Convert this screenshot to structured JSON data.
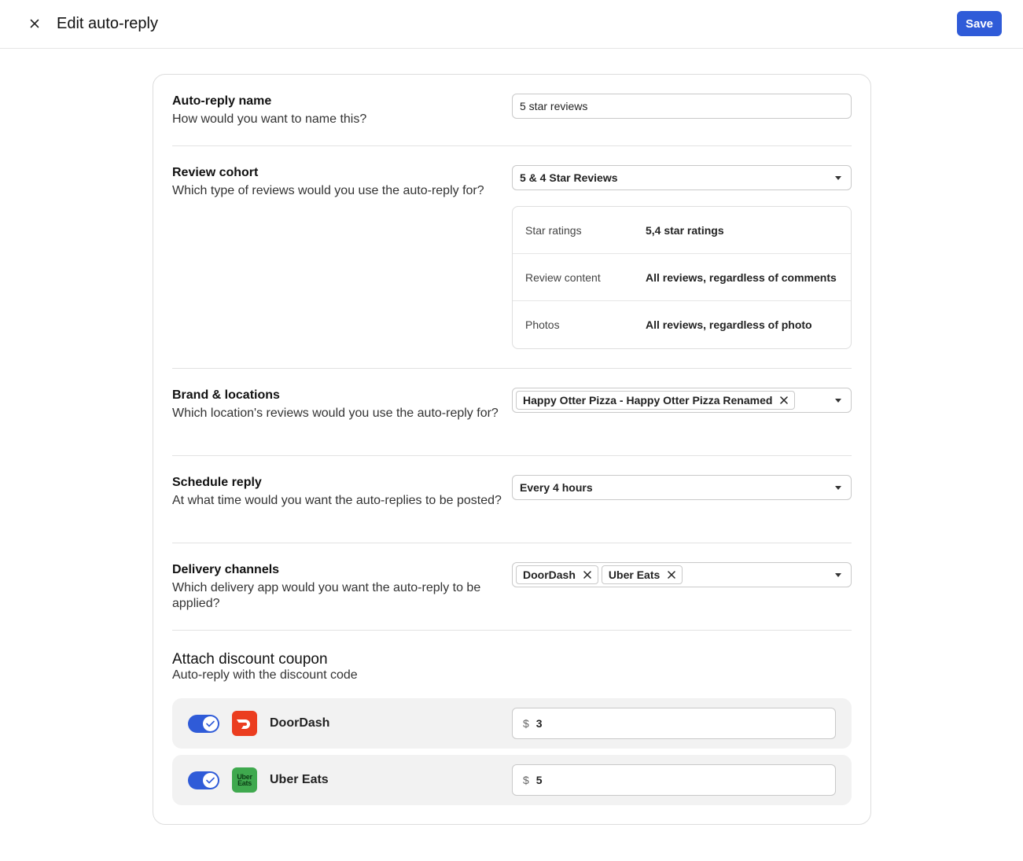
{
  "header": {
    "title": "Edit auto-reply",
    "save_label": "Save"
  },
  "auto_reply_name": {
    "title": "Auto-reply name",
    "description": "How would you want to name this?",
    "value": "5 star reviews"
  },
  "review_cohort": {
    "title": "Review cohort",
    "description": "Which type of reviews would you use the auto-reply for?",
    "selected": "5 & 4 Star Reviews",
    "details": [
      {
        "label": "Star ratings",
        "value": "5,4 star ratings"
      },
      {
        "label": "Review content",
        "value": "All reviews, regardless of comments"
      },
      {
        "label": "Photos",
        "value": "All reviews, regardless of photo"
      }
    ]
  },
  "brand_locations": {
    "title": "Brand & locations",
    "description": "Which location's reviews would you use the auto-reply for?",
    "chips": [
      "Happy Otter Pizza - Happy Otter Pizza Renamed"
    ]
  },
  "schedule_reply": {
    "title": "Schedule reply",
    "description": "At what time would you want the auto-replies to be posted?",
    "selected": "Every 4 hours"
  },
  "delivery_channels": {
    "title": "Delivery channels",
    "description": "Which delivery app would you want the auto-reply to be applied?",
    "chips": [
      "DoorDash",
      "Uber Eats"
    ]
  },
  "discount_coupon": {
    "title": "Attach discount coupon",
    "description": "Auto-reply with the discount code",
    "currency_symbol": "$",
    "rows": [
      {
        "app": "DoorDash",
        "enabled": true,
        "amount": "3",
        "logo": "doordash-logo",
        "color": "#eb3d1f"
      },
      {
        "app": "Uber Eats",
        "enabled": true,
        "amount": "5",
        "logo": "ubereats-logo",
        "color": "#3fa94e",
        "logo_text_line1": "Uber",
        "logo_text_line2": "Eats"
      }
    ]
  },
  "colors": {
    "accent": "#2f5bd8"
  }
}
